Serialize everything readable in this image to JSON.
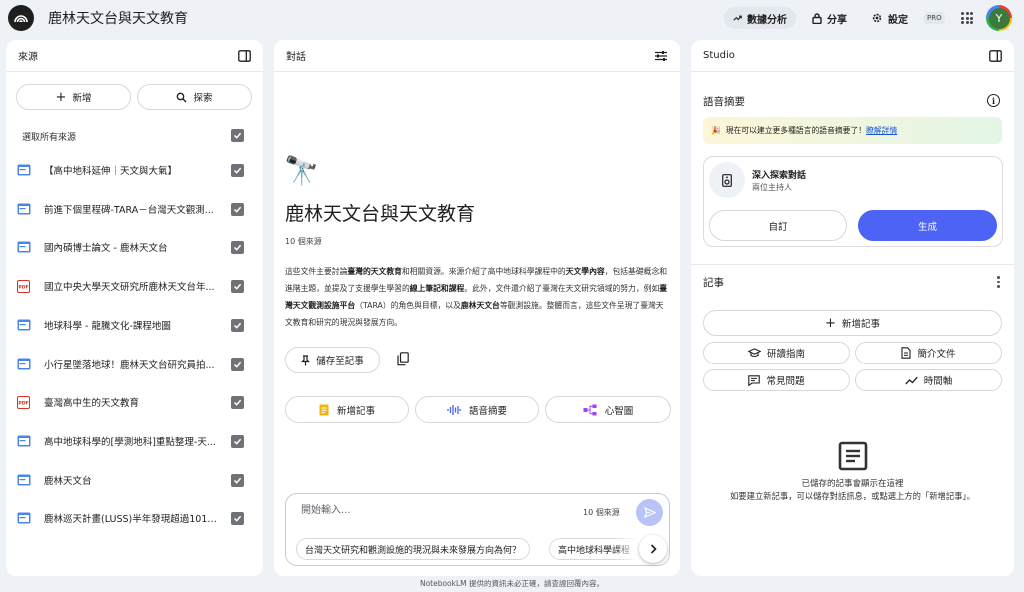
{
  "header": {
    "title": "鹿林天文台與天文教育",
    "analytics_label": "數據分析",
    "share_label": "分享",
    "settings_label": "設定",
    "pro_badge": "PRO",
    "avatar_letter": "Y"
  },
  "sources": {
    "title": "來源",
    "add_label": "新增",
    "discover_label": "探索",
    "select_all_label": "選取所有來源",
    "items": [
      {
        "label": "【高中地科延伸｜天文與大氣】",
        "icon": "web-page-icon",
        "checked": true
      },
      {
        "label": "前進下個里程碑-TARA－台灣天文觀測...",
        "icon": "web-page-icon",
        "checked": true
      },
      {
        "label": "國內碩博士論文 - 鹿林天文台",
        "icon": "web-page-icon",
        "checked": true
      },
      {
        "label": "國立中央大學天文研究所鹿林天文台年...",
        "icon": "pdf-icon",
        "checked": true
      },
      {
        "label": "地球科學 - 龍騰文化-課程地圖",
        "icon": "web-page-icon",
        "checked": true
      },
      {
        "label": "小行星墜落地球！鹿林天文台研究員拍...",
        "icon": "web-page-icon",
        "checked": true
      },
      {
        "label": "臺灣高中生的天文教育",
        "icon": "pdf-icon",
        "checked": true
      },
      {
        "label": "高中地球科學的[學測地科]重點整理-天...",
        "icon": "web-page-icon",
        "checked": true
      },
      {
        "label": "鹿林天文台",
        "icon": "web-page-icon",
        "checked": true
      },
      {
        "label": "鹿林巡天計畫(LUSS)半年發現超過101顆...",
        "icon": "web-page-icon",
        "checked": true
      }
    ]
  },
  "chat": {
    "title": "對話",
    "emoji": "🔭",
    "notebook_title": "鹿林天文台與天文教育",
    "source_count": "10 個來源",
    "summary_segments": [
      {
        "t": "這些文件主要討論",
        "b": false
      },
      {
        "t": "臺灣的天文教育",
        "b": true
      },
      {
        "t": "和相關資源。來源介紹了高中地球科學課程中的",
        "b": false
      },
      {
        "t": "天文學內容",
        "b": true
      },
      {
        "t": "，包括基礎概念和進階主題，並提及了支援學生學習的",
        "b": false
      },
      {
        "t": "線上筆記和課程",
        "b": true
      },
      {
        "t": "。此外，文件還介紹了臺灣在天文研究領域的努力，例如",
        "b": false
      },
      {
        "t": "臺灣天文觀測設施平台",
        "b": true
      },
      {
        "t": "（TARA）的角色與目標，以及",
        "b": false
      },
      {
        "t": "鹿林天文台",
        "b": true
      },
      {
        "t": "等觀測設施。整體而言，這些文件呈現了臺灣天文教育和研究的現況與發展方向。",
        "b": false
      }
    ],
    "save_note_label": "儲存至記事",
    "add_note_label": "新增記事",
    "audio_overview_label": "語音摘要",
    "mind_map_label": "心智圖",
    "input_placeholder": "開始輸入...",
    "input_source_count": "10 個來源",
    "suggestions": [
      "台灣天文研究和觀測設施的現況與未來發展方向為何？",
      "高中地球科學課程"
    ]
  },
  "studio": {
    "title": "Studio",
    "audio_overview_title": "語音摘要",
    "banner_text": "現在可以建立更多種語言的語音摘要了！",
    "banner_link": "瞭解詳情",
    "banner_emoji": "🎉",
    "deep_dive_title": "深入探索對話",
    "deep_dive_subtitle": "兩位主持人",
    "customize_label": "自訂",
    "generate_label": "生成",
    "notes_title": "記事",
    "add_note_label": "新增記事",
    "study_guide_label": "研讀指南",
    "briefing_doc_label": "簡介文件",
    "faq_label": "常見問題",
    "timeline_label": "時間軸",
    "empty_title": "已儲存的記事會顯示在這裡",
    "empty_desc": "如要建立新記事，可以儲存對話訊息，或點選上方的「新增記事」。"
  },
  "footer": {
    "disclaimer": "NotebookLM 提供的資訊未必正確，請查證回覆內容。"
  },
  "colors": {
    "accent": "#4c63f5",
    "pdf_red": "#d93025",
    "web_blue": "#4a86e8",
    "banner_start": "#fdf6d8",
    "banner_end": "#e3f6e6"
  }
}
